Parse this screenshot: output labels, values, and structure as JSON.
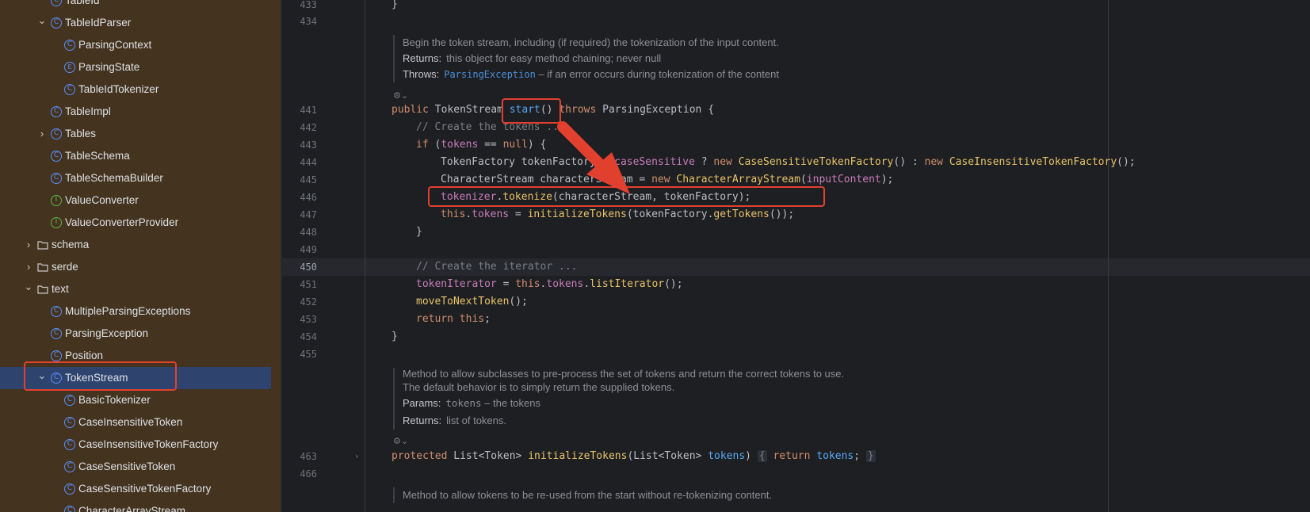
{
  "sidebar": {
    "items": [
      {
        "label": "TableId",
        "icon": "class-icon",
        "indent": 3,
        "chevron": ""
      },
      {
        "label": "TableIdParser",
        "icon": "class-icon",
        "indent": 3,
        "chevron": "open"
      },
      {
        "label": "ParsingContext",
        "icon": "class-icon",
        "indent": 4,
        "chevron": ""
      },
      {
        "label": "ParsingState",
        "icon": "enum-icon",
        "indent": 4,
        "chevron": ""
      },
      {
        "label": "TableIdTokenizer",
        "icon": "class-icon",
        "indent": 4,
        "chevron": ""
      },
      {
        "label": "TableImpl",
        "icon": "class-icon",
        "indent": 3,
        "chevron": ""
      },
      {
        "label": "Tables",
        "icon": "class-icon",
        "indent": 3,
        "chevron": "closed"
      },
      {
        "label": "TableSchema",
        "icon": "class-icon",
        "indent": 3,
        "chevron": ""
      },
      {
        "label": "TableSchemaBuilder",
        "icon": "class-icon",
        "indent": 3,
        "chevron": ""
      },
      {
        "label": "ValueConverter",
        "icon": "interface-icon",
        "indent": 3,
        "chevron": ""
      },
      {
        "label": "ValueConverterProvider",
        "icon": "interface-icon",
        "indent": 3,
        "chevron": ""
      },
      {
        "label": "schema",
        "icon": "folder-icon",
        "indent": 2,
        "chevron": "closed"
      },
      {
        "label": "serde",
        "icon": "folder-icon",
        "indent": 2,
        "chevron": "closed"
      },
      {
        "label": "text",
        "icon": "folder-icon",
        "indent": 2,
        "chevron": "open"
      },
      {
        "label": "MultipleParsingExceptions",
        "icon": "class-icon",
        "indent": 3,
        "chevron": ""
      },
      {
        "label": "ParsingException",
        "icon": "class-icon",
        "indent": 3,
        "chevron": ""
      },
      {
        "label": "Position",
        "icon": "class-icon",
        "indent": 3,
        "chevron": ""
      },
      {
        "label": "TokenStream",
        "icon": "class-icon",
        "indent": 3,
        "chevron": "open",
        "selected": true
      },
      {
        "label": "BasicTokenizer",
        "icon": "class-icon",
        "indent": 4,
        "chevron": ""
      },
      {
        "label": "CaseInsensitiveToken",
        "icon": "class-icon",
        "indent": 4,
        "chevron": ""
      },
      {
        "label": "CaseInsensitiveTokenFactory",
        "icon": "class-icon",
        "indent": 4,
        "chevron": ""
      },
      {
        "label": "CaseSensitiveToken",
        "icon": "class-icon",
        "indent": 4,
        "chevron": ""
      },
      {
        "label": "CaseSensitiveTokenFactory",
        "icon": "class-icon",
        "indent": 4,
        "chevron": ""
      },
      {
        "label": "CharacterArrayStream",
        "icon": "class-icon",
        "indent": 4,
        "chevron": ""
      }
    ]
  },
  "editor": {
    "line_numbers": {
      "n433": "433",
      "n434": "434",
      "n441": "441",
      "n442": "442",
      "n443": "443",
      "n444": "444",
      "n445": "445",
      "n446": "446",
      "n447": "447",
      "n448": "448",
      "n449": "449",
      "n450": "450",
      "n451": "451",
      "n452": "452",
      "n453": "453",
      "n454": "454",
      "n455": "455",
      "n463": "463",
      "n466": "466"
    },
    "doc1": {
      "summary": "Begin the token stream, including (if required) the tokenization of the input content.",
      "returns_key": "Returns:",
      "returns_val": "this object for easy method chaining; never null",
      "throws_key": "Throws:",
      "throws_link": "ParsingException",
      "throws_val": " – if an error occurs during tokenization of the content"
    },
    "code": {
      "l433": "}",
      "l441_kw": "public",
      "l441_type": " TokenStream ",
      "l441_fn": "start",
      "l441_rest": "() ",
      "l441_kw2": "throws",
      "l441_exc": " ParsingException {",
      "l442": "// Create the tokens ...",
      "l443_kw": "if",
      "l443_a": " (",
      "l443_field": "tokens",
      "l443_b": " == ",
      "l443_kw2": "null",
      "l443_c": ") {",
      "l444_a": "TokenFactory tokenFactory = ",
      "l444_field": "caseSensitive",
      "l444_b": " ? ",
      "l444_kw": "new",
      "l444_cls": " CaseSensitiveTokenFactory",
      "l444_c": "() : ",
      "l444_kw2": "new",
      "l444_cls2": " CaseInsensitiveTokenFactory",
      "l444_d": "();",
      "l445_a": "CharacterStream characterStream = ",
      "l445_kw": "new",
      "l445_cls": " CharacterArrayStream",
      "l445_b": "(",
      "l445_field": "inputContent",
      "l445_c": ");",
      "l446_field": "tokenizer",
      "l446_a": ".",
      "l446_m": "tokenize",
      "l446_b": "(characterStream, tokenFactory);",
      "l447_kw": "this",
      "l447_a": ".",
      "l447_field": "tokens",
      "l447_b": " = ",
      "l447_m": "initializeTokens",
      "l447_c": "(tokenFactory.",
      "l447_m2": "getTokens",
      "l447_d": "());",
      "l448": "}",
      "l450": "// Create the iterator ...",
      "l451_field": "tokenIterator",
      "l451_a": " = ",
      "l451_kw": "this",
      "l451_b": ".",
      "l451_field2": "tokens",
      "l451_c": ".",
      "l451_m": "listIterator",
      "l451_d": "();",
      "l452_m": "moveToNextToken",
      "l452_a": "();",
      "l453_kw": "return",
      "l453_kw2": " this",
      "l453_a": ";",
      "l454": "}",
      "l463_kw": "protected",
      "l463_a": " List<Token> ",
      "l463_fn": "initializeTokens",
      "l463_b": "(List<Token> ",
      "l463_p": "tokens",
      "l463_c": ") ",
      "l463_fold1": "{",
      "l463_kw2": " return",
      "l463_p2": " tokens",
      "l463_d": "; ",
      "l463_fold2": "}"
    },
    "doc2": {
      "line1": "Method to allow subclasses to pre-process the set of tokens and return the correct tokens to use.",
      "line2": "The default behavior is to simply return the supplied tokens.",
      "params_key": "Params:",
      "params_code": "tokens",
      "params_val": " – the tokens",
      "returns_key": "Returns:",
      "returns_val": "list of tokens."
    },
    "doc3": {
      "summary": "Method to allow tokens to be re-used from the start without re-tokenizing content."
    }
  },
  "colors": {
    "sidebar_bg": "#43331f",
    "selection_bg": "#2e436e",
    "editor_bg": "#1e1f22",
    "annotation_red": "#e2402f"
  }
}
